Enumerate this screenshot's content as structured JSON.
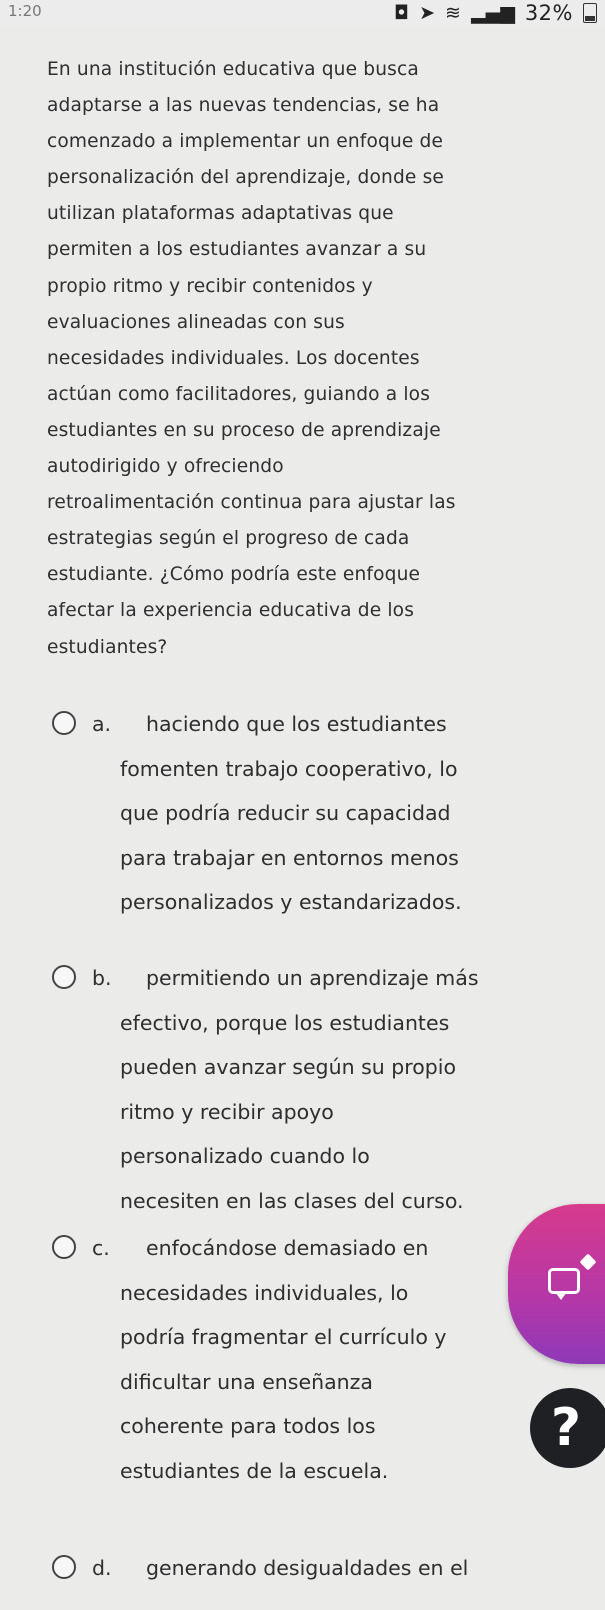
{
  "status_bar": {
    "time": "1:20",
    "battery": "32%",
    "icons": [
      "notification-icon",
      "location-icon",
      "wifi-icon",
      "signal-icon",
      "battery-icon"
    ]
  },
  "question": {
    "lines": [
      "En una institución educativa que busca",
      "adaptarse a las nuevas tendencias, se ha",
      "comenzado a implementar un enfoque de",
      "personalización del aprendizaje, donde se",
      "utilizan plataformas adaptativas que",
      "permiten a los estudiantes avanzar a su",
      "propio ritmo y recibir contenidos y",
      "evaluaciones alineadas con sus",
      "necesidades individuales. Los docentes",
      "actúan como facilitadores, guiando a los",
      "estudiantes en su proceso de aprendizaje",
      "autodirigido y ofreciendo",
      "retroalimentación continua para ajustar las",
      "estrategias según el progreso de cada",
      "estudiante. ¿Cómo podría este enfoque",
      "afectar la experiencia educativa de los",
      "estudiantes?"
    ]
  },
  "options": [
    {
      "letter": "a.",
      "lines": [
        "haciendo que los estudiantes",
        "fomenten trabajo cooperativo, lo",
        "que podría reducir su capacidad",
        "para trabajar en entornos menos",
        "personalizados y estandarizados."
      ]
    },
    {
      "letter": "b.",
      "lines": [
        "permitiendo un aprendizaje más",
        "efectivo, porque los estudiantes",
        "pueden avanzar según su propio",
        "ritmo y recibir apoyo",
        "personalizado cuando lo",
        "necesiten en las clases del curso."
      ]
    },
    {
      "letter": "c.",
      "lines": [
        "enfocándose demasiado en",
        "necesidades individuales, lo",
        "podría fragmentar el currículo y",
        "dificultar una enseñanza",
        "coherente para todos los",
        "estudiantes de la escuela."
      ]
    },
    {
      "letter": "d.",
      "lines": [
        "generando desigualdades en el"
      ]
    }
  ],
  "help_button": {
    "label": "?"
  },
  "colors": {
    "background": "#ebebea",
    "text": "#2f2f30",
    "bubble_gradient_top": "#d63b8c",
    "bubble_gradient_bottom": "#8e39b8",
    "help_button": "#1f2024"
  }
}
